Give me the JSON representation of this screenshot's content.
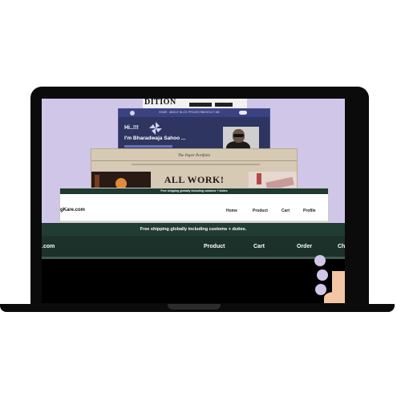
{
  "colors": {
    "screen_background": "#cfc6e8",
    "store_green": "#1b3129",
    "portfolio_navy": "#2e3561",
    "paper_tan": "#d6cab5"
  },
  "card1": {
    "heading_fragment": "DITION"
  },
  "card2": {
    "greeting": "Hi..!!!",
    "name": "I'm Bharadwaja Sahoo ...",
    "nav": [
      "HOME",
      "ABOUT",
      "BLOG",
      "PROJECTS",
      "CONTACT ME"
    ],
    "logo_icon": "pinwheel-icon"
  },
  "card3": {
    "title": "The Paper Portfolio",
    "heading": "ALL WORK!"
  },
  "card4": {
    "banner": "Free shipping globally including customs + duties",
    "brand": "gKare.com",
    "nav": [
      "Home",
      "Product",
      "Cart",
      "Profile"
    ]
  },
  "card5": {
    "banner": "Free shipping globally including customs + duties.",
    "brand": ".com",
    "nav": [
      "Product",
      "Cart",
      "Order",
      "Ch"
    ]
  }
}
